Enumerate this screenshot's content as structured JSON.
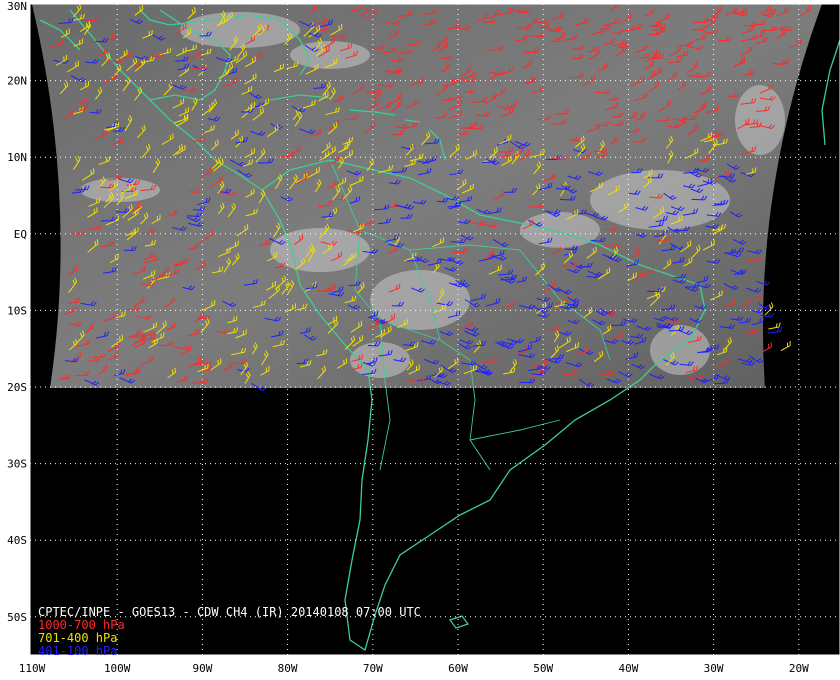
{
  "map": {
    "lat_labels": [
      "30N",
      "20N",
      "10N",
      "EQ",
      "10S",
      "20S",
      "30S",
      "40S",
      "50S"
    ],
    "lon_labels": [
      "110W",
      "100W",
      "90W",
      "80W",
      "70W",
      "60W",
      "50W",
      "40W",
      "30W",
      "20W"
    ],
    "lat_values": [
      30,
      20,
      10,
      0,
      -10,
      -20,
      -30,
      -40,
      -50
    ],
    "lon_values": [
      -110,
      -100,
      -90,
      -80,
      -70,
      -60,
      -50,
      -40,
      -30,
      -20
    ],
    "extent": {
      "lon_min": -110,
      "lon_max": -15,
      "lat_min": -55,
      "lat_max": 30
    },
    "imagery_extent": {
      "lon_min": -105,
      "lon_max": -25,
      "lat_min": -20,
      "lat_max": 30
    }
  },
  "caption": {
    "title": "CPTEC/INPE - GOES13 - CDW CH4 (IR) 20140108 07:00 UTC",
    "legend": [
      {
        "label": "1000-700 hPa",
        "color": "#ff2a2a"
      },
      {
        "label": "701-400 hPa",
        "color": "#f0e000"
      },
      {
        "label": "401-100 hPa",
        "color": "#2020ff"
      }
    ]
  },
  "colors": {
    "background": "#000000",
    "coastline": "#3ccf95",
    "grid": "#ffffff",
    "frame": "#ffffff"
  }
}
